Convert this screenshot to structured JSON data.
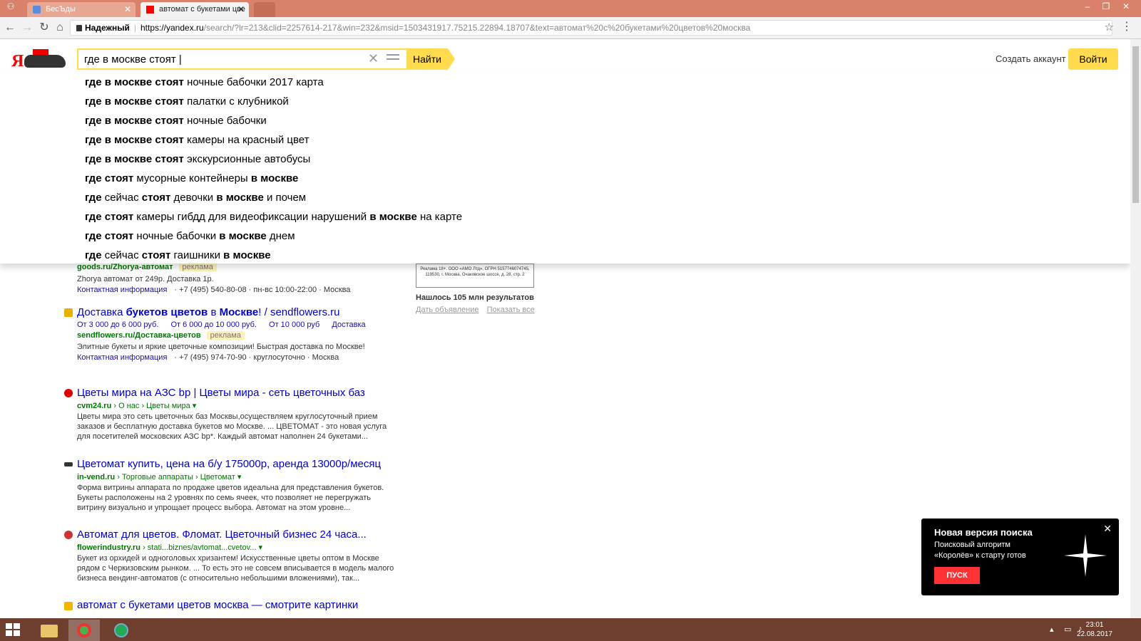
{
  "browser": {
    "tabs": [
      {
        "label": "БесЪды",
        "active": false
      },
      {
        "label": "автомат с букетами цве",
        "active": true
      }
    ],
    "address": {
      "secure_label": "Надежный",
      "url_host": "https://yandex.ru",
      "url_path": "/search/?lr=213&clid=2257614-217&win=232&msid=1503431917.75215.22894.18707&text=автомат%20с%20букетами%20цветов%20москва"
    }
  },
  "header": {
    "logo_text": "Я",
    "search_value": "где в москве стоят |",
    "find_label": "Найти",
    "create_account": "Создать аккаунт",
    "login_label": "Войти"
  },
  "suggestions": [
    {
      "pre": "где в москве стоят",
      "rest": " ночные бабочки 2017 карта"
    },
    {
      "pre": "где в москве стоят",
      "rest": " палатки с клубникой"
    },
    {
      "pre": "где в москве стоят",
      "rest": " ночные бабочки"
    },
    {
      "pre": "где в москве стоят",
      "rest": " камеры на красный цвет"
    },
    {
      "pre": "где в москве стоят",
      "rest": " экскурсионные автобусы"
    },
    {
      "html_parts": [
        "где стоят",
        " мусорные контейнеры ",
        "в москве",
        ""
      ]
    },
    {
      "html_parts": [
        "где",
        " сейчас ",
        "стоят",
        " девочки ",
        "в москве",
        " и почем"
      ]
    },
    {
      "html_parts": [
        "где стоят",
        " камеры гибдд для видеофиксации нарушений ",
        "в москве",
        " на карте"
      ]
    },
    {
      "html_parts": [
        "где стоят",
        " ночные бабочки ",
        "в москве",
        " днем"
      ]
    },
    {
      "html_parts": [
        "где",
        " сейчас ",
        "стоят",
        " гаишники ",
        "в москве"
      ]
    }
  ],
  "sidebar_ad": {
    "ad_text_line1": "Реклама 18+. ООО «АМО Лтд», ОГРН 5157746074745,",
    "ad_text_line2": "119530, г. Москва, Очаковское шоссе, д. 28, стр. 2",
    "found": "Нашлось 105 млн результатов",
    "link_place_ad": "Дать объявление",
    "link_show_all": "Показать все"
  },
  "results": {
    "r0": {
      "url": "goods.ru/Zhorya-автомат",
      "ad_badge": "реклама",
      "snippet": "Zhorya автомат от 249р. Доставка 1р.",
      "contact": "Контактная информация",
      "phone": "+7 (495) 540-80-08",
      "hours": "пн-вс 10:00-22:00",
      "city": "Москва"
    },
    "r1": {
      "title_parts": [
        "Доставка ",
        "букетов цветов",
        " в ",
        "Москве",
        "! / sendflowers.ru"
      ],
      "sitelinks": [
        "От 3 000 до 6 000 руб.",
        "От 6 000 до 10 000 руб.",
        "От 10 000 руб",
        "Доставка"
      ],
      "url": "sendflowers.ru/Доставка-цветов",
      "ad_badge": "реклама",
      "snippet": "Элитные букеты и яркие цветочные композиции! Быстрая доставка по Москве!",
      "contact": "Контактная информация",
      "phone": "+7 (495) 974-70-90",
      "hours": "круглосуточно",
      "city": "Москва"
    },
    "r2": {
      "title": "Цветы мира на АЗС bp | Цветы мира - сеть цветочных баз",
      "url_host": "cvm24.ru",
      "url_path": " › О нас › Цветы мира ▾",
      "snippet1": "Цветы мира это сеть цветочных баз Москвы,осуществляем круглосуточный прием",
      "snippet2": "заказов и бесплатную доставка букетов мо Москве. ... ЦВЕТОМАТ - это новая услуга",
      "snippet3": "для посетителей московских АЗС bp*. Каждый автомат наполнен 24 букетами..."
    },
    "r3": {
      "title": "Цветомат купить, цена на б/у 175000р, аренда 13000р/месяц",
      "url_host": "in-vend.ru",
      "url_path": " › Торговые аппараты › Цветомат ▾",
      "snippet1": "Форма витрины аппарата по продаже цветов идеальна для представления букетов.",
      "snippet2": "Букеты расположены на 2 уровнях по семь ячеек, что позволяет не перегружать",
      "snippet3": "витрину визуально и упрощает процесс выбора. Автомат на этом уровне..."
    },
    "r4": {
      "title": "Автомат для цветов. Фломат. Цветочный бизнес 24 часа...",
      "url_host": "flowerindustry.ru",
      "url_path": " › stati...biznes/avtomat...cvetov... ▾",
      "snippet1": "Букет из орхидей и одноголовых хризантем! Искусственные цветы оптом в Москве",
      "snippet2": "рядом с Черкизовским рынком. ... То есть это не совсем вписывается в модель малого",
      "snippet3": "бизнеса вендинг-автоматов (с относительно небольшими вложениями), так..."
    },
    "r5": {
      "title": "автомат с букетами цветов москва — смотрите картинки"
    }
  },
  "promo": {
    "title": "Новая версия поиска",
    "line1": "Поисковый алгоритм",
    "line2": "«Королёв» к старту готов",
    "button": "ПУСК",
    "close": "✕"
  },
  "taskbar": {
    "time": "23:01",
    "date": "22.08.2017"
  },
  "colors": {
    "accent": "#ffdb4d",
    "link": "#0000cc",
    "url_green": "#007700",
    "taskbar": "#6e3f2e"
  }
}
